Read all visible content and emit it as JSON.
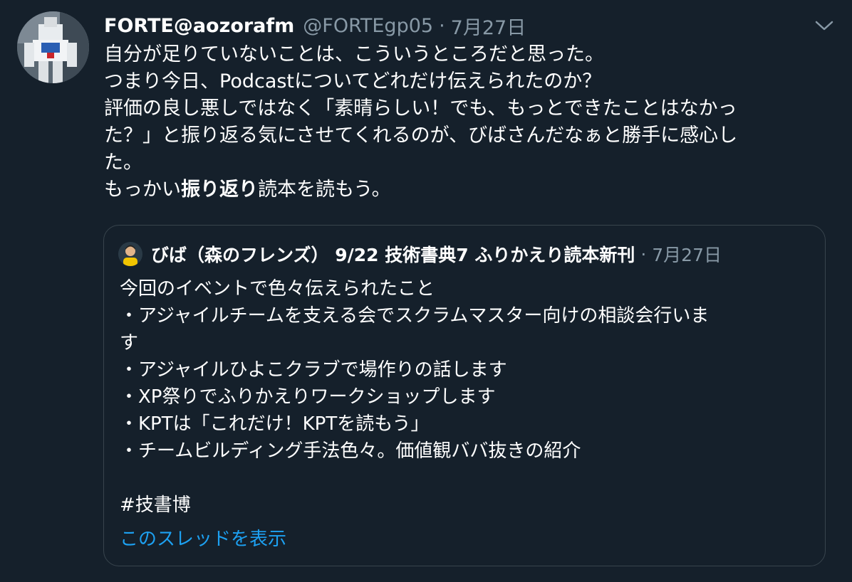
{
  "tweet": {
    "display_name": "FORTE@aozorafm",
    "handle": "@FORTEgp05",
    "separator": "·",
    "date": "7月27日",
    "avatar_icon": "robot-avatar-icon",
    "menu_icon": "chevron-down-icon",
    "text_lines": [
      "自分が足りていないことは、こういうところだと思った。",
      "つまり今日、Podcastについてどれだけ伝えられたのか？",
      "評価の良し悪しではなく「素晴らしい！でも、もっとできたことはなかっ",
      "た？」と振り返る気にさせてくれるのが、びばさんだなぁと勝手に感心し",
      "た。"
    ],
    "last_line": {
      "prefix": "もっかい",
      "bold": "振り返り",
      "suffix": "読本を読もう。"
    }
  },
  "quote": {
    "display_name": "びば（森のフレンズ） 9/22 技術書典7 ふりかえり読本新刊",
    "separator": "·",
    "date": "7月27日",
    "avatar_icon": "person-avatar-icon",
    "text_lines": [
      "今回のイベントで色々伝えられたこと",
      "・アジャイルチームを支える会でスクラムマスター向けの相談会行いま",
      "す",
      "・アジャイルひよこクラブで場作りの話します",
      "・XP祭りでふりかえりワークショップします",
      "・KPTは「これだけ！KPTを読もう」",
      "・チームビルディング手法色々。価値観ババ抜きの紹介",
      "",
      "#技書博"
    ],
    "thread_link": "このスレッドを表示"
  },
  "colors": {
    "background": "#15202b",
    "text": "#ffffff",
    "secondary": "#8899a6",
    "border": "#38444d",
    "link": "#1da1f2"
  }
}
